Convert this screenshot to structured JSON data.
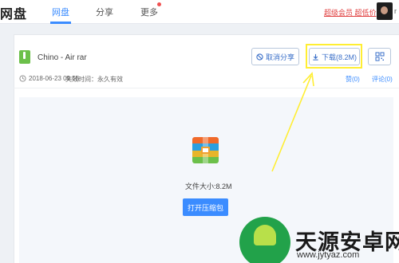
{
  "nav": {
    "brand": "网盘",
    "items": [
      {
        "label": "网盘",
        "active": true
      },
      {
        "label": "分享",
        "active": false
      },
      {
        "label": "更多",
        "active": false
      }
    ],
    "vip_link": "超级会员 超低价",
    "user_initial": "r",
    "accent_color": "#3b8cff"
  },
  "file": {
    "name": "Chino - Air rar",
    "date": "2018-06-23 09:55",
    "expire": "失效时间：永久有效",
    "size_label": "文件大小:8.2M",
    "icon": "rar-archive-icon"
  },
  "actions": {
    "cancel_share": "取消分享",
    "download": "下载(8.2M)",
    "qr_icon": "qr-code-icon"
  },
  "stats": {
    "likes": "赞(0)",
    "comments": "评论(0)"
  },
  "preview": {
    "open_button": "打开压缩包"
  },
  "watermark": {
    "text": "天源安卓网",
    "url": "www.jytyaz.com",
    "color": "#22a24a"
  },
  "annotation": {
    "color": "#ffee33"
  }
}
